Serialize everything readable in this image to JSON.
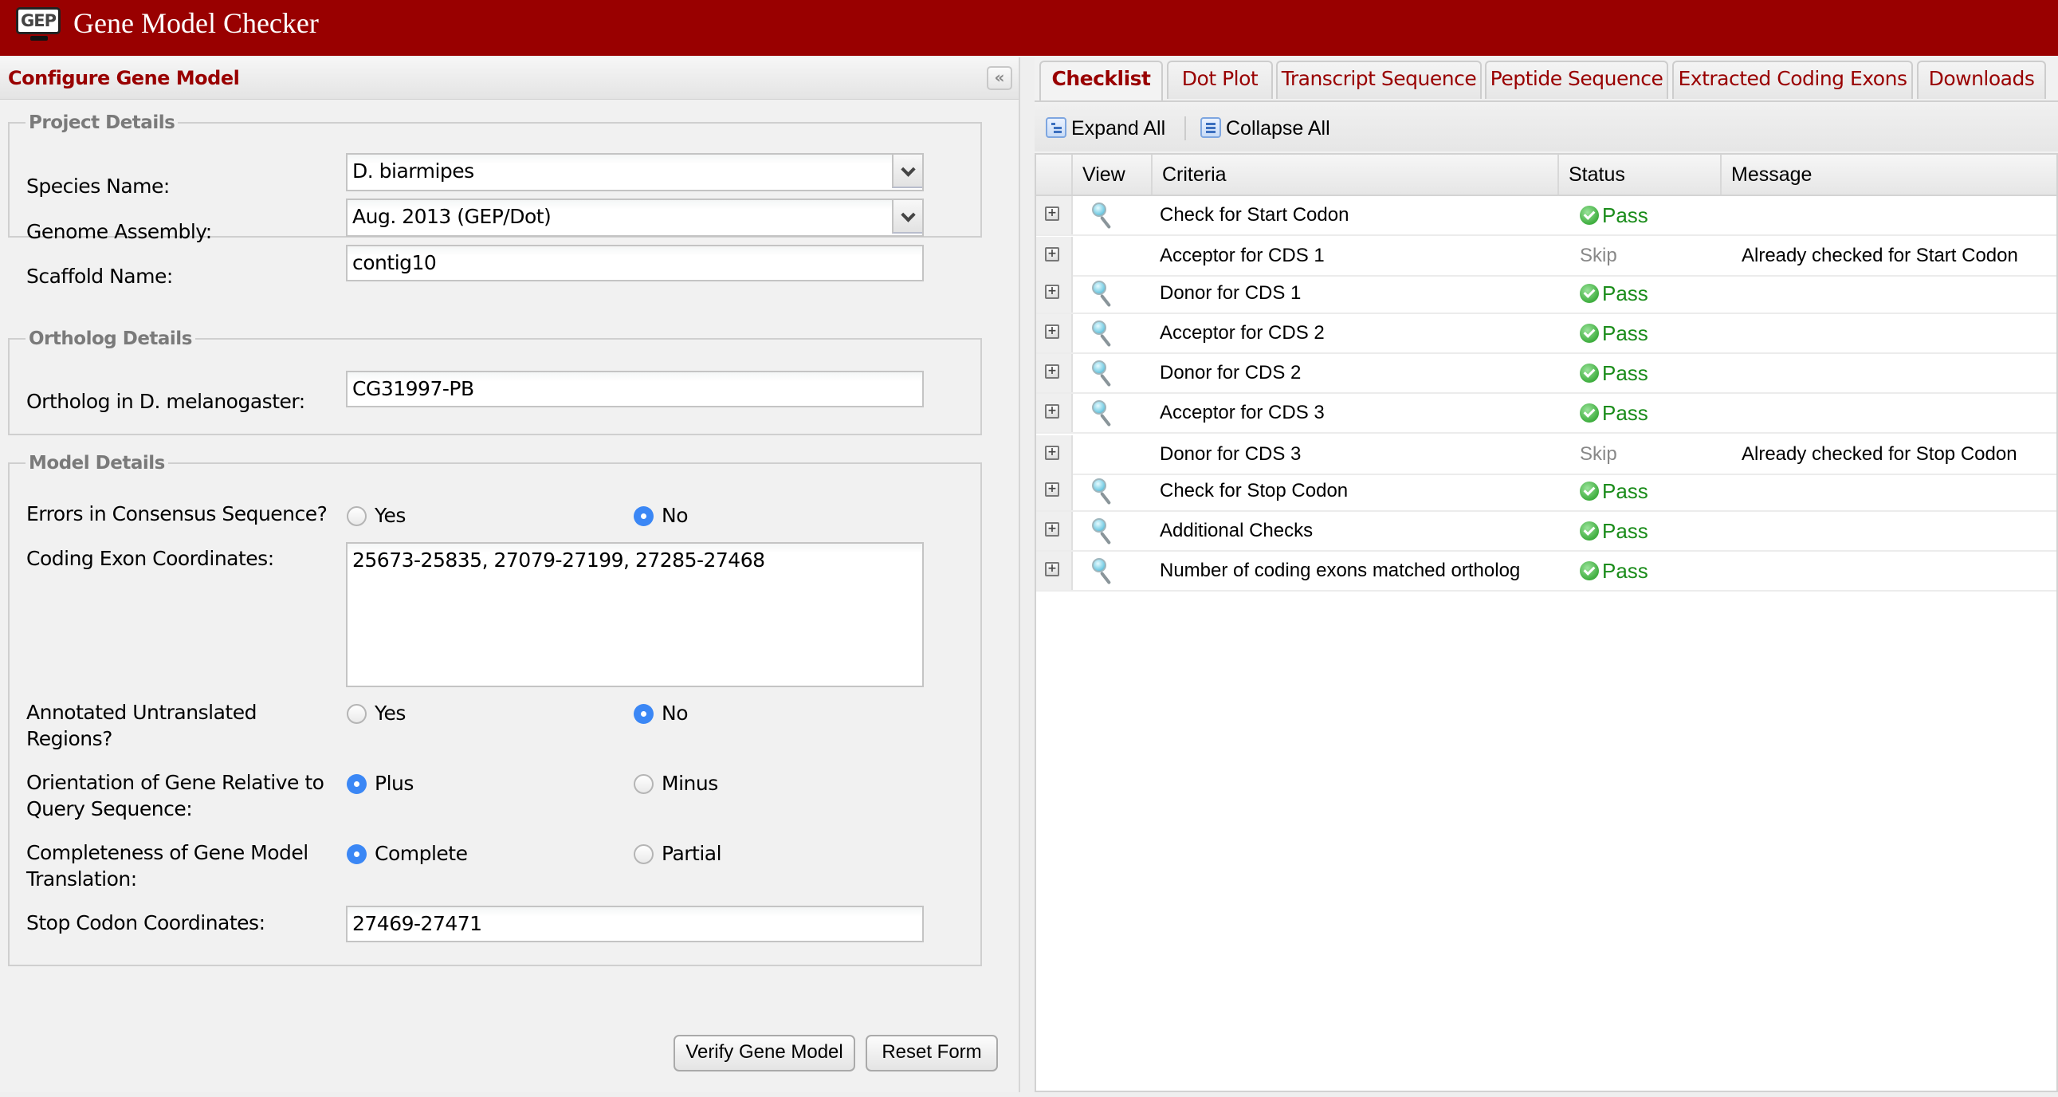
{
  "app": {
    "logo_text": "GEP",
    "title": "Gene Model Checker",
    "brand_color": "#990000"
  },
  "left_panel": {
    "title": "Configure Gene Model",
    "collapse_icon": "double-chevron-left",
    "project_details": {
      "legend": "Project Details",
      "species_label": "Species Name:",
      "species_value": "D. biarmipes",
      "assembly_label": "Genome Assembly:",
      "assembly_value": "Aug. 2013 (GEP/Dot)",
      "scaffold_label": "Scaffold Name:",
      "scaffold_value": "contig10"
    },
    "ortholog_details": {
      "legend": "Ortholog Details",
      "ortholog_label": "Ortholog in D. melanogaster:",
      "ortholog_value": "CG31997-PB"
    },
    "model_details": {
      "legend": "Model Details",
      "errors_label": "Errors in Consensus Sequence?",
      "errors_options": [
        {
          "label": "Yes",
          "selected": false
        },
        {
          "label": "No",
          "selected": true
        }
      ],
      "exons_label": "Coding Exon Coordinates:",
      "exons_value": "25673-25835, 27079-27199, 27285-27468",
      "utr_label_line1": "Annotated Untranslated",
      "utr_label_line2": "Regions?",
      "utr_options": [
        {
          "label": "Yes",
          "selected": false
        },
        {
          "label": "No",
          "selected": true
        }
      ],
      "orientation_label_line1": "Orientation of Gene Relative to",
      "orientation_label_line2": "Query Sequence:",
      "orientation_options": [
        {
          "label": "Plus",
          "selected": true
        },
        {
          "label": "Minus",
          "selected": false
        }
      ],
      "completeness_label_line1": "Completeness of Gene Model",
      "completeness_label_line2": "Translation:",
      "completeness_options": [
        {
          "label": "Complete",
          "selected": true
        },
        {
          "label": "Partial",
          "selected": false
        }
      ],
      "stop_label": "Stop Codon Coordinates:",
      "stop_value": "27469-27471"
    },
    "buttons": {
      "verify": "Verify Gene Model",
      "reset": "Reset Form"
    }
  },
  "right_panel": {
    "tabs": [
      {
        "label": "Checklist",
        "active": true
      },
      {
        "label": "Dot Plot",
        "active": false
      },
      {
        "label": "Transcript Sequence",
        "active": false
      },
      {
        "label": "Peptide Sequence",
        "active": false
      },
      {
        "label": "Extracted Coding Exons",
        "active": false
      },
      {
        "label": "Downloads",
        "active": false
      }
    ],
    "toolbar": {
      "expand_all": "Expand All",
      "collapse_all": "Collapse All"
    },
    "table": {
      "columns": [
        "View",
        "Criteria",
        "Status",
        "Message"
      ],
      "rows": [
        {
          "view": true,
          "criteria": "Check for Start Codon",
          "status": "Pass",
          "message": ""
        },
        {
          "view": false,
          "criteria": "Acceptor for CDS 1",
          "status": "Skip",
          "message": "Already checked for Start Codon"
        },
        {
          "view": true,
          "criteria": "Donor for CDS 1",
          "status": "Pass",
          "message": ""
        },
        {
          "view": true,
          "criteria": "Acceptor for CDS 2",
          "status": "Pass",
          "message": ""
        },
        {
          "view": true,
          "criteria": "Donor for CDS 2",
          "status": "Pass",
          "message": ""
        },
        {
          "view": true,
          "criteria": "Acceptor for CDS 3",
          "status": "Pass",
          "message": ""
        },
        {
          "view": false,
          "criteria": "Donor for CDS 3",
          "status": "Skip",
          "message": "Already checked for Stop Codon"
        },
        {
          "view": true,
          "criteria": "Check for Stop Codon",
          "status": "Pass",
          "message": ""
        },
        {
          "view": true,
          "criteria": "Additional Checks",
          "status": "Pass",
          "message": ""
        },
        {
          "view": true,
          "criteria": "Number of coding exons matched ortholog",
          "status": "Pass",
          "message": ""
        }
      ]
    },
    "status_colors": {
      "pass": "#1a8c1a",
      "skip": "#888888"
    }
  }
}
